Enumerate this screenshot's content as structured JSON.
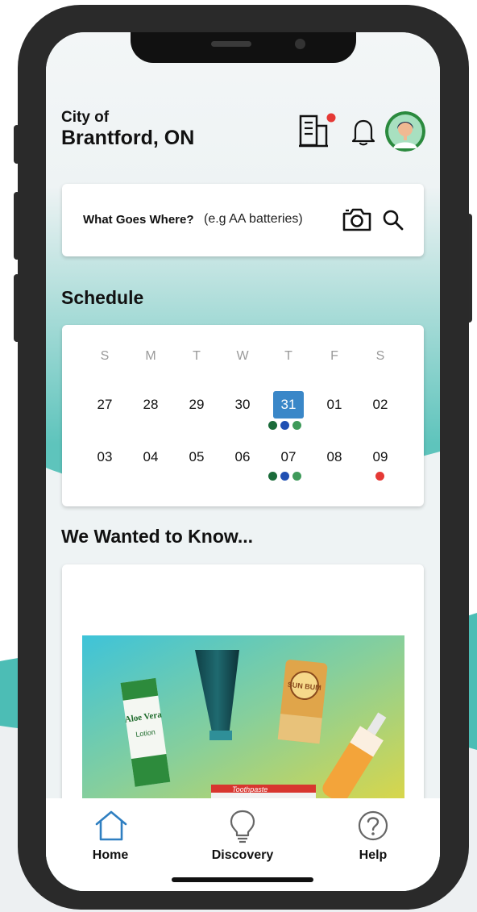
{
  "header": {
    "city_prefix": "City of",
    "city_name": "Brantford, ON",
    "icons": [
      "building-icon",
      "bell-icon",
      "avatar"
    ],
    "notification_dot_color": "#e53935"
  },
  "search": {
    "label": "What Goes Where?",
    "hint": "(e.g AA batteries)",
    "icons": [
      "camera-icon",
      "search-icon"
    ]
  },
  "schedule": {
    "title": "Schedule",
    "weekdays": [
      "S",
      "M",
      "T",
      "W",
      "T",
      "F",
      "S"
    ],
    "weeks": [
      [
        "27",
        "28",
        "29",
        "30",
        "31",
        "01",
        "02"
      ],
      [
        "03",
        "04",
        "05",
        "06",
        "07",
        "08",
        "09"
      ]
    ],
    "selected_day": "31",
    "dot_colors": {
      "green_dark": "#1b6b3a",
      "blue": "#1f4fb3",
      "green": "#3f9a5a",
      "red": "#e53935"
    }
  },
  "promo": {
    "title": "We Wanted to Know...",
    "image_text": [
      "Aloe Vera",
      "Lotion",
      "SUN BUM",
      "Toothpaste"
    ]
  },
  "tabs": [
    {
      "label": "Home"
    },
    {
      "label": "Discovery"
    },
    {
      "label": "Help"
    }
  ],
  "colors": {
    "accent_teal": "#4fc0ba",
    "selected_blue": "#3a87c8",
    "home_icon_blue": "#2f7fc1"
  }
}
